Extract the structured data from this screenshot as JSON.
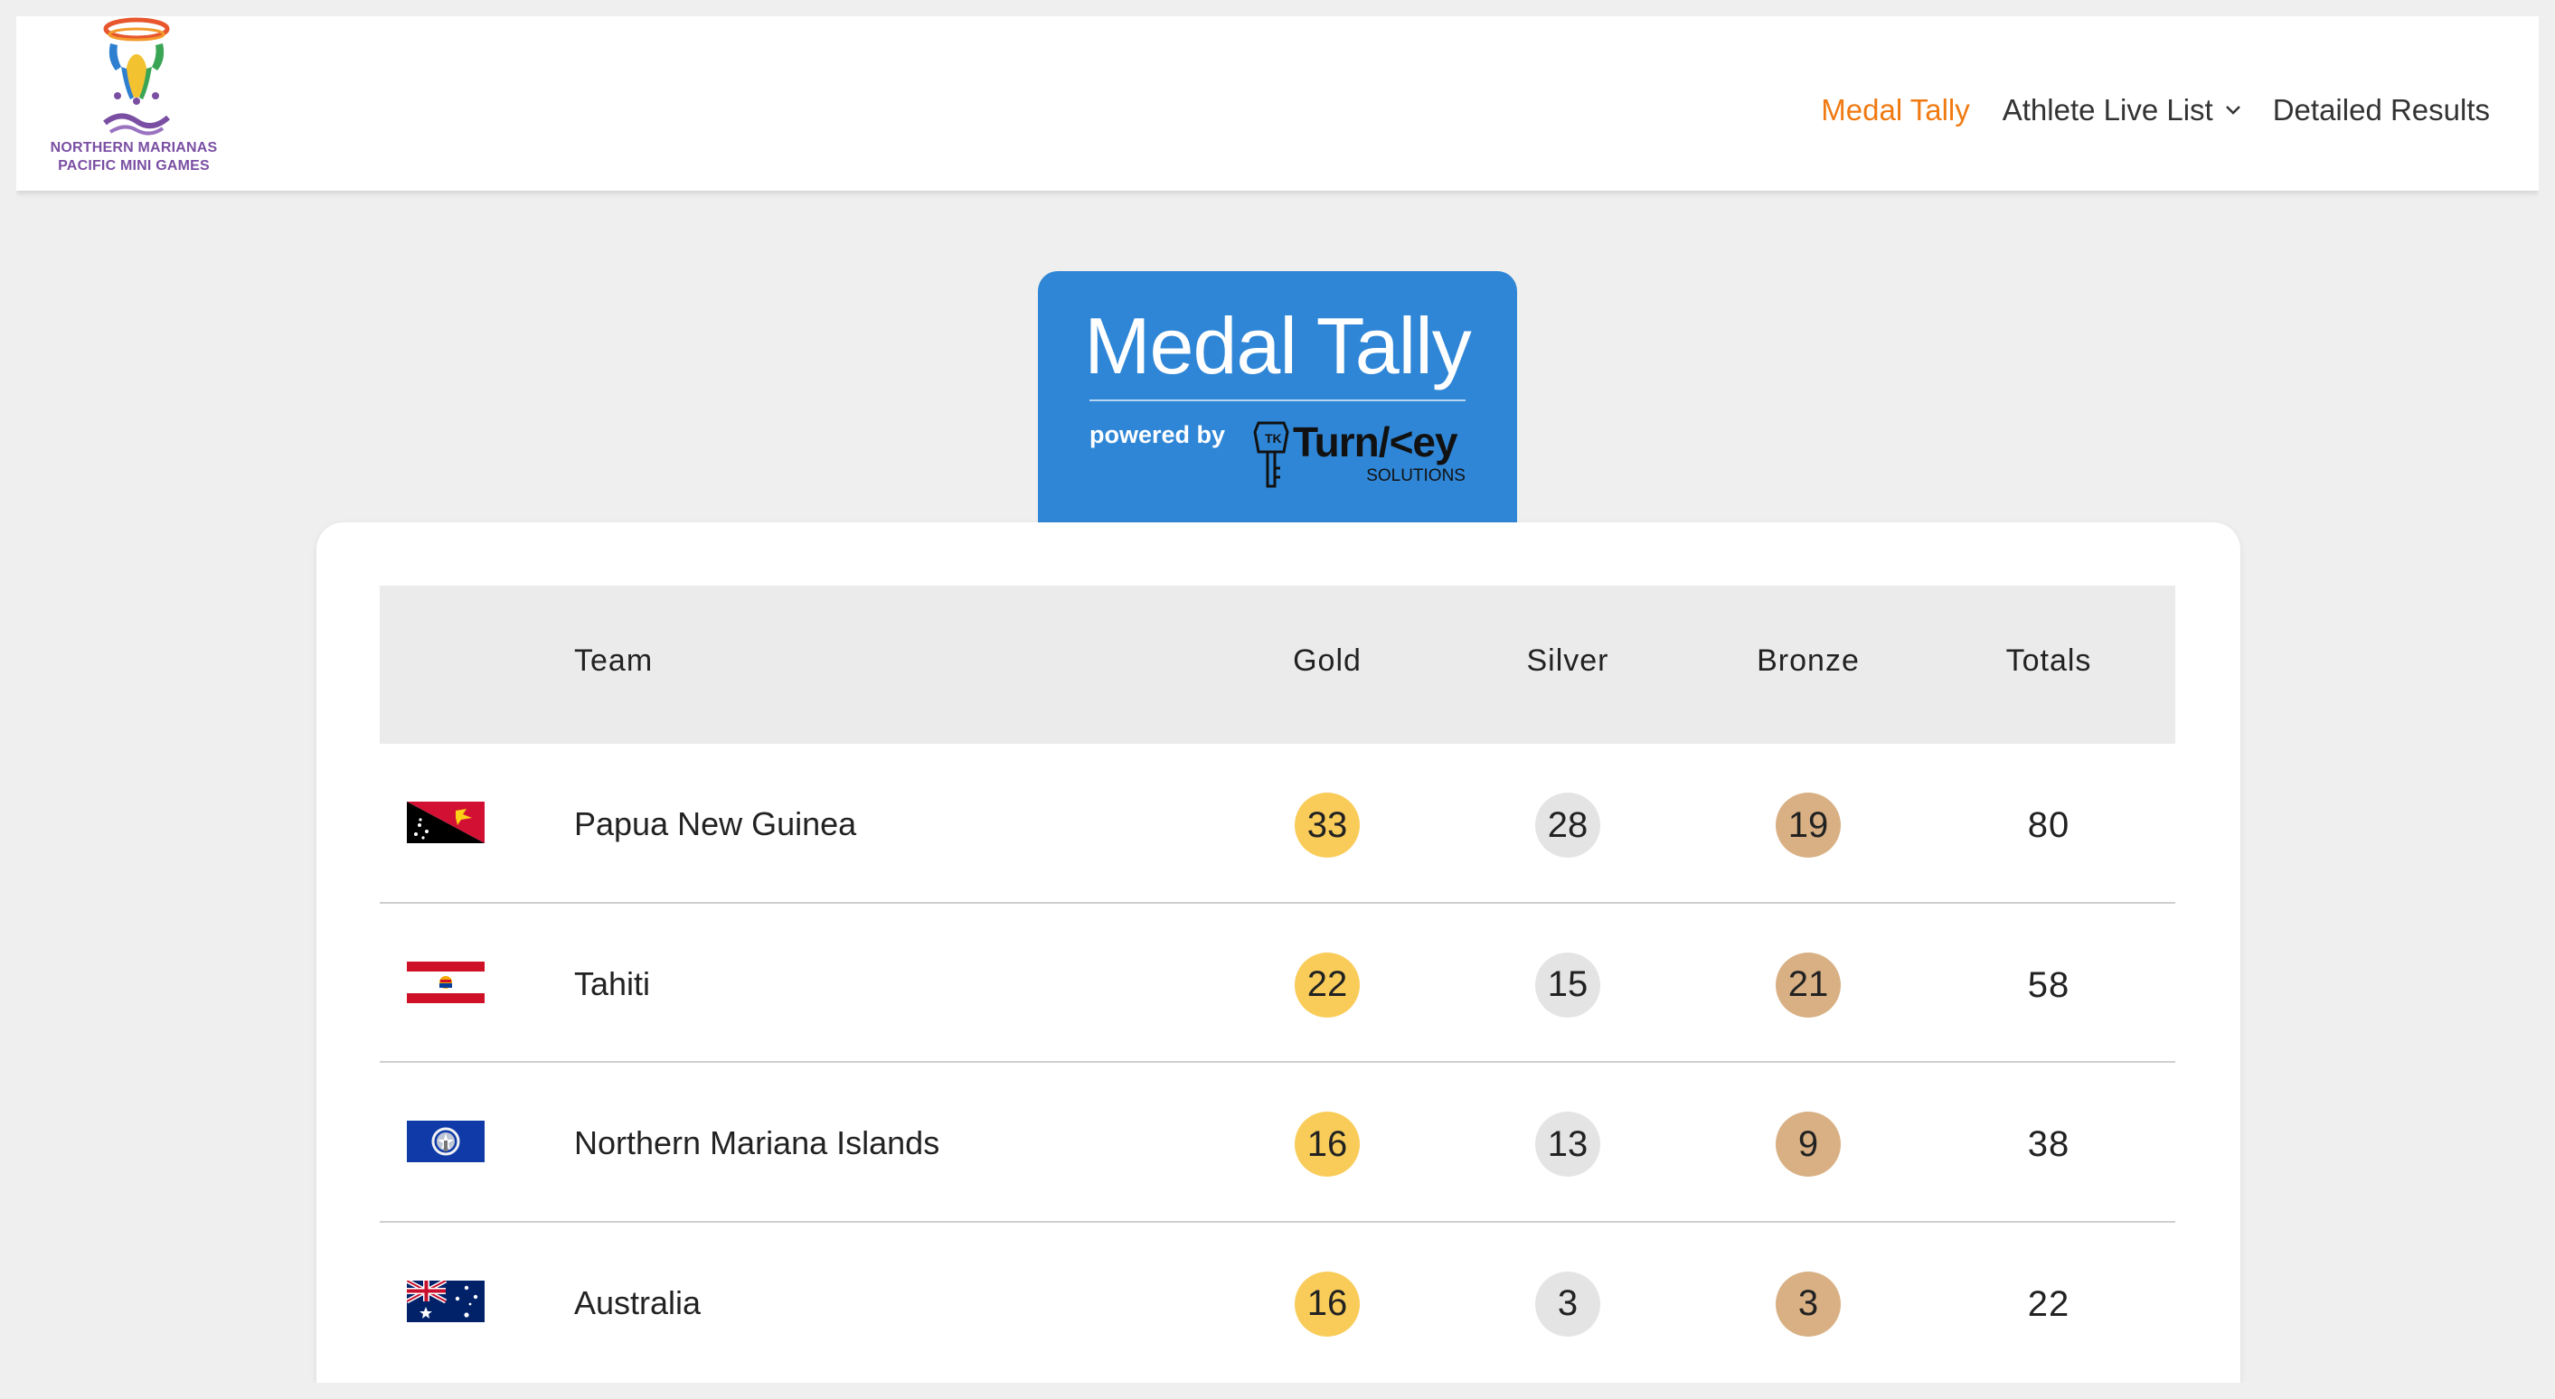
{
  "header": {
    "logo_line1": "NORTHERN MARIANAS",
    "logo_line2": "PACIFIC MINI GAMES",
    "nav": {
      "medal_tally": "Medal Tally",
      "athlete_live_list": "Athlete Live List",
      "detailed_results": "Detailed Results"
    },
    "active_color": "#f07a12"
  },
  "title_tab": {
    "title": "Medal Tally",
    "powered_by": "powered by",
    "brand": "Turn/<ey",
    "brand_sub": "SOLUTIONS",
    "background": "#2f86d6"
  },
  "table": {
    "columns": {
      "team": "Team",
      "gold": "Gold",
      "silver": "Silver",
      "bronze": "Bronze",
      "totals": "Totals"
    },
    "rows": [
      {
        "team": "Papua New Guinea",
        "flag": "papua-new-guinea-flag",
        "gold": "33",
        "silver": "28",
        "bronze": "19",
        "total": "80"
      },
      {
        "team": "Tahiti",
        "flag": "tahiti-flag",
        "gold": "22",
        "silver": "15",
        "bronze": "21",
        "total": "58"
      },
      {
        "team": "Northern Mariana Islands",
        "flag": "northern-mariana-islands-flag",
        "gold": "16",
        "silver": "13",
        "bronze": "9",
        "total": "38"
      },
      {
        "team": "Australia",
        "flag": "australia-flag",
        "gold": "16",
        "silver": "3",
        "bronze": "3",
        "total": "22"
      }
    ],
    "medal_colors": {
      "gold": "#f9cc5a",
      "silver": "#e4e4e4",
      "bronze": "#d8b084"
    }
  }
}
